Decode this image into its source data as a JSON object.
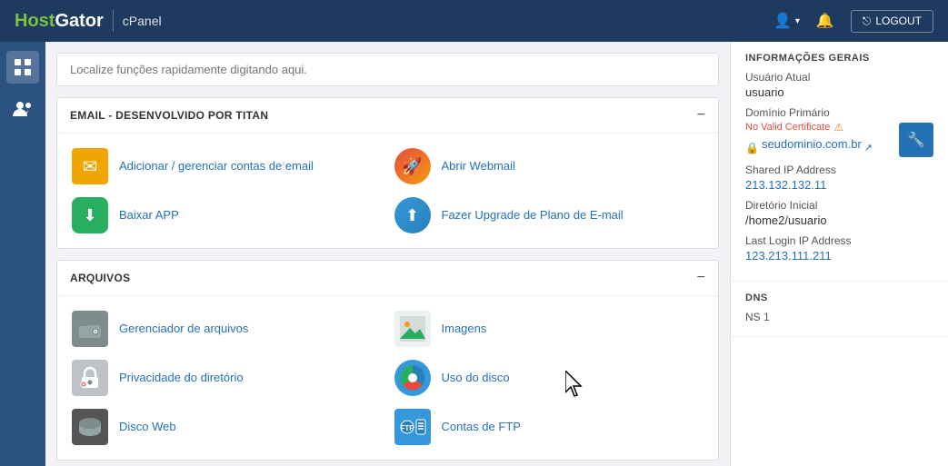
{
  "topnav": {
    "brand": "HostGator",
    "brand_highlight": "Host",
    "cpanel_label": "cPanel",
    "user_icon": "👤",
    "user_dropdown": "▾",
    "bell_icon": "🔔",
    "logout_icon": "⬛",
    "logout_label": "LOGOUT"
  },
  "sidebar": {
    "grid_icon": "⊞",
    "users_icon": "👥"
  },
  "search": {
    "placeholder": "Localize funções rapidamente digitando aqui."
  },
  "email_section": {
    "title": "EMAIL - DESENVOLVIDO POR TITAN",
    "toggle": "−",
    "items": [
      {
        "label": "Adicionar / gerenciar contas de email",
        "icon": "email"
      },
      {
        "label": "Abrir Webmail",
        "icon": "webmail"
      },
      {
        "label": "Baixar APP",
        "icon": "app"
      },
      {
        "label": "Fazer Upgrade de Plano de E-mail",
        "icon": "upgrade"
      }
    ]
  },
  "arquivos_section": {
    "title": "ARQUIVOS",
    "toggle": "−",
    "items": [
      {
        "label": "Gerenciador de arquivos",
        "icon": "filemanager"
      },
      {
        "label": "Imagens",
        "icon": "images"
      },
      {
        "label": "Privacidade do diretório",
        "icon": "privacy"
      },
      {
        "label": "Uso do disco",
        "icon": "disk"
      },
      {
        "label": "Disco Web",
        "icon": "webdisk"
      },
      {
        "label": "Contas de FTP",
        "icon": "ftp"
      }
    ]
  },
  "right_panel": {
    "general_info_title": "INFORMAÇÕES GERAIS",
    "current_user_label": "Usuário Atual",
    "current_user_value": "usuario",
    "primary_domain_label": "Domínio Primário",
    "no_valid_cert": "No Valid Certificate",
    "warning_symbol": "⚠",
    "lock_symbol": "🔒",
    "domain_link": "seudominio.com.br",
    "external_link": "↗",
    "shared_ip_label": "Shared IP Address",
    "shared_ip_value": "213.132.132.11",
    "home_dir_label": "Diretório Inicial",
    "home_dir_value": "/home2/usuario",
    "last_login_label": "Last Login IP Address",
    "last_login_value": "123.213.111.211",
    "dns_title": "DNS",
    "ns1_label": "NS 1"
  }
}
